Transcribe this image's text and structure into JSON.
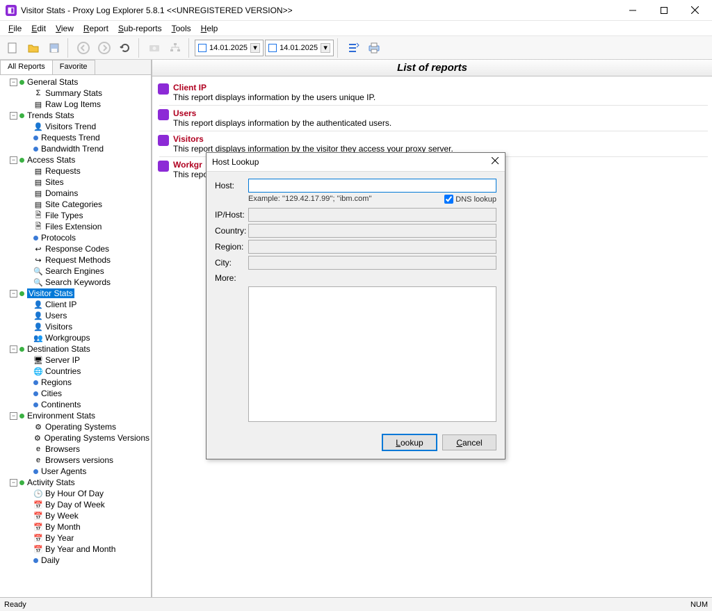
{
  "window": {
    "title": "Visitor Stats - Proxy Log Explorer 5.8.1 <<UNREGISTERED VERSION>>"
  },
  "menu": [
    "File",
    "Edit",
    "View",
    "Report",
    "Sub-reports",
    "Tools",
    "Help"
  ],
  "toolbar": {
    "date1": "14.01.2025",
    "date2": "14.01.2025"
  },
  "sidebar": {
    "tabs": [
      "All Reports",
      "Favorite"
    ],
    "tree": {
      "general_stats": "General Stats",
      "summary_stats": "Summary Stats",
      "raw_log_items": "Raw Log Items",
      "trends_stats": "Trends Stats",
      "visitors_trend": "Visitors Trend",
      "requests_trend": "Requests Trend",
      "bandwidth_trend": "Bandwidth Trend",
      "access_stats": "Access Stats",
      "requests": "Requests",
      "sites": "Sites",
      "domains": "Domains",
      "site_categories": "Site Categories",
      "file_types": "File Types",
      "files_extension": "Files Extension",
      "protocols": "Protocols",
      "response_codes": "Response Codes",
      "request_methods": "Request Methods",
      "search_engines": "Search Engines",
      "search_keywords": "Search Keywords",
      "visitor_stats": "Visitor Stats",
      "client_ip": "Client IP",
      "users": "Users",
      "visitors": "Visitors",
      "workgroups": "Workgroups",
      "destination_stats": "Destination Stats",
      "server_ip": "Server IP",
      "countries": "Countries",
      "regions": "Regions",
      "cities": "Cities",
      "continents": "Continents",
      "environment_stats": "Environment Stats",
      "operating_systems": "Operating Systems",
      "os_versions": "Operating Systems Versions",
      "browsers": "Browsers",
      "browsers_versions": "Browsers versions",
      "user_agents": "User Agents",
      "activity_stats": "Activity Stats",
      "by_hour": "By Hour Of Day",
      "by_dow": "By Day of Week",
      "by_week": "By Week",
      "by_month": "By Month",
      "by_year": "By Year",
      "by_year_month": "By Year and Month",
      "daily": "Daily"
    }
  },
  "content": {
    "header": "List of reports",
    "reports": [
      {
        "title": "Client IP",
        "desc": "This report displays information by the users unique IP."
      },
      {
        "title": "Users",
        "desc": "This report displays information by the authenticated users."
      },
      {
        "title": "Visitors",
        "desc": "This report displays information by the visitor they access your proxy server."
      },
      {
        "title": "Workgr",
        "desc": "This repor"
      }
    ]
  },
  "dialog": {
    "title": "Host Lookup",
    "host_label": "Host:",
    "host_value": "",
    "example": "Example: ''129.42.17.99''; ''ibm.com''",
    "dns_lookup": "DNS lookup",
    "iphost_label": "IP/Host:",
    "country_label": "Country:",
    "region_label": "Region:",
    "city_label": "City:",
    "more_label": "More:",
    "lookup_btn": "Lookup",
    "cancel_btn": "Cancel"
  },
  "statusbar": {
    "ready": "Ready",
    "num": "NUM"
  }
}
